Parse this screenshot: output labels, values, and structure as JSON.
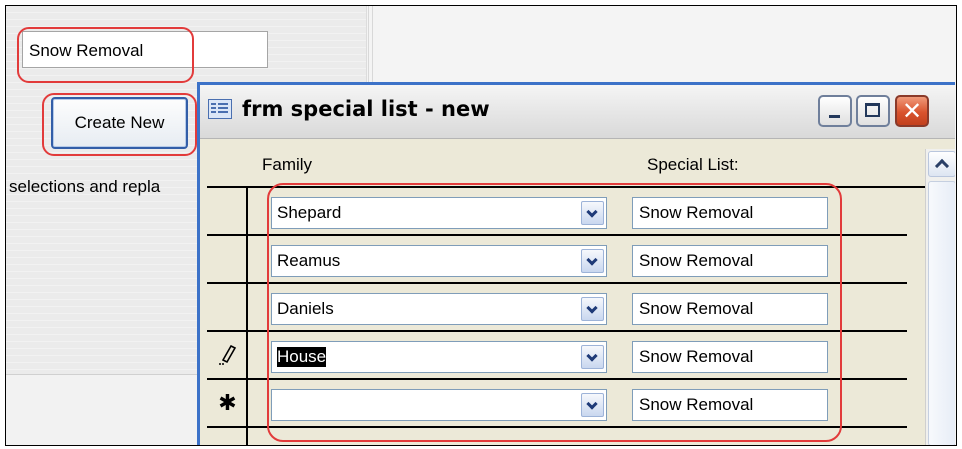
{
  "background": {
    "search_field_value": "Snow Removal",
    "create_button_label": "Create New",
    "truncated_text": "selections and repla"
  },
  "window": {
    "title": "frm special list - new",
    "buttons": {
      "minimize": "minimize",
      "maximize": "maximize",
      "close": "close"
    }
  },
  "grid": {
    "headers": {
      "family": "Family",
      "special_list": "Special List:"
    },
    "rows": [
      {
        "selector": "",
        "family": "Shepard",
        "special": "Snow Removal",
        "selected": false
      },
      {
        "selector": "",
        "family": "Reamus",
        "special": "Snow Removal",
        "selected": false
      },
      {
        "selector": "",
        "family": "Daniels",
        "special": "Snow Removal",
        "selected": false
      },
      {
        "selector": "pencil",
        "family": "House",
        "special": "Snow Removal",
        "selected": true
      },
      {
        "selector": "new-record",
        "family": "",
        "special": "Snow Removal",
        "selected": false
      }
    ]
  },
  "colors": {
    "highlight_red": "#e23b3b",
    "button_border_blue": "#335ea8",
    "window_border_blue": "#3c72c8",
    "close_red": "#d9532e"
  },
  "icons": [
    "form-icon",
    "minimize-icon",
    "maximize-icon",
    "close-icon",
    "dropdown-chevron-icon",
    "pencil-icon",
    "new-record-asterisk-icon",
    "scroll-up-icon"
  ]
}
